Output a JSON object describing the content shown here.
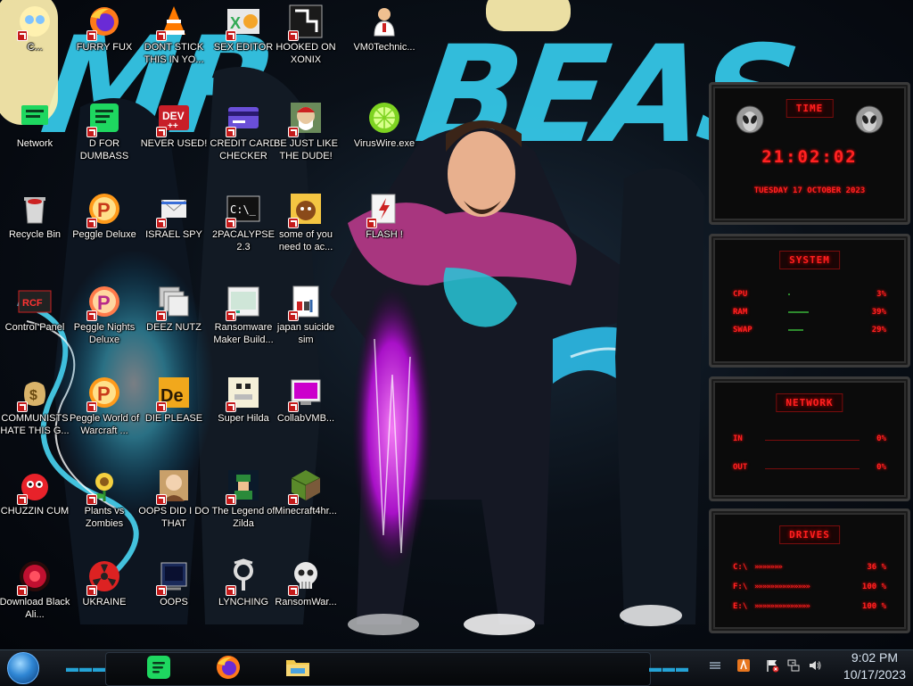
{
  "desktop": {
    "icons": [
      {
        "id": "c1",
        "label": "C..."
      },
      {
        "id": "furryfux",
        "label": "FURRY FUX"
      },
      {
        "id": "dontstick",
        "label": "DONT STICK THIS IN YO..."
      },
      {
        "id": "sexeditor",
        "label": "SEX EDITOR"
      },
      {
        "id": "hookedon",
        "label": "HOOKED ON XONIX"
      },
      {
        "id": "vm0",
        "label": "VM0Technic..."
      },
      {
        "id": "network",
        "label": "Network"
      },
      {
        "id": "dforr",
        "label": "D FOR DUMBASS"
      },
      {
        "id": "neverused",
        "label": "NEVER USED!"
      },
      {
        "id": "creditcard",
        "label": "CREDIT CARD CHECKER"
      },
      {
        "id": "bejust",
        "label": "BE JUST LIKE THE DUDE!"
      },
      {
        "id": "viruswire",
        "label": "VirusWire.exe"
      },
      {
        "id": "recyclebin",
        "label": "Recycle Bin"
      },
      {
        "id": "peggle",
        "label": "Peggle Deluxe"
      },
      {
        "id": "israelspy",
        "label": "ISRAEL SPY"
      },
      {
        "id": "2pacalypse",
        "label": "2PACALYPSE 2.3"
      },
      {
        "id": "someofyou",
        "label": "some of you need to ac..."
      },
      {
        "id": "flash",
        "label": "FLASH !"
      },
      {
        "id": "controlpanel",
        "label": "Control Panel"
      },
      {
        "id": "pegglenights",
        "label": "Peggle Nights Deluxe"
      },
      {
        "id": "deeznutz",
        "label": "DEEZ NUTZ"
      },
      {
        "id": "ransomware",
        "label": "Ransomware Maker Build..."
      },
      {
        "id": "japan",
        "label": "japan suicide sim"
      },
      {
        "id": "communists",
        "label": "COMMUNISTS HATE THIS G..."
      },
      {
        "id": "pegglewow",
        "label": "Peggle World of Warcraft ..."
      },
      {
        "id": "dieplease",
        "label": "DIE PLEASE"
      },
      {
        "id": "superhilda",
        "label": "Super Hilda"
      },
      {
        "id": "collabvm",
        "label": "CollabVMB..."
      },
      {
        "id": "chuzzin",
        "label": "CHUZZIN CUM"
      },
      {
        "id": "pvz",
        "label": "Plants vs Zombies"
      },
      {
        "id": "oopsdid",
        "label": "OOPS DID I DO THAT"
      },
      {
        "id": "zilda",
        "label": "The Legend of Zilda"
      },
      {
        "id": "minecraft",
        "label": "Minecraft4hr..."
      },
      {
        "id": "blackali",
        "label": "Download Black Ali..."
      },
      {
        "id": "ukraine",
        "label": "UKRAINE"
      },
      {
        "id": "oops",
        "label": "OOPS"
      },
      {
        "id": "lynching",
        "label": "LYNCHING"
      },
      {
        "id": "ransomwar",
        "label": "RansomWar..."
      }
    ]
  },
  "widgets": {
    "time": {
      "header": "TIME",
      "clock": "21:02:02",
      "date": "TUESDAY 17 OCTOBER 2023"
    },
    "system": {
      "header": "SYSTEM",
      "rows": [
        {
          "label": "CPU",
          "value": "3%",
          "fill": 0.03
        },
        {
          "label": "RAM",
          "value": "39%",
          "fill": 0.39
        },
        {
          "label": "SWAP",
          "value": "29%",
          "fill": 0.29
        }
      ]
    },
    "network": {
      "header": "NETWORK",
      "rows": [
        {
          "label": "IN",
          "value": "0%"
        },
        {
          "label": "OUT",
          "value": "0%"
        }
      ]
    },
    "drives": {
      "header": "DRIVES",
      "rows": [
        {
          "label": "C:\\",
          "value": "36 %"
        },
        {
          "label": "F:\\",
          "value": "100 %"
        },
        {
          "label": "E:\\",
          "value": "100 %"
        }
      ]
    }
  },
  "taskbar": {
    "apps": [
      {
        "name": "Spotify"
      },
      {
        "name": "Firefox"
      },
      {
        "name": "File Explorer"
      }
    ],
    "clock": {
      "time": "9:02 PM",
      "date": "10/17/2023"
    }
  },
  "colors": {
    "accent": "#ff2222",
    "wallpaper_cyan": "#35c6e6",
    "glow_pink": "#e040ff"
  }
}
